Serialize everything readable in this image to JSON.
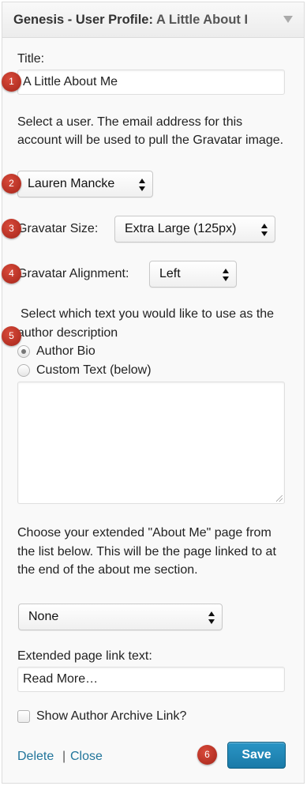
{
  "header": {
    "title_prefix": "Genesis - User Profile",
    "title_separator": ":",
    "instance_title": "A Little About I"
  },
  "fields": {
    "title_label": "Title:",
    "title_value": "A Little About Me",
    "user_help": "Select a user. The email address for this account will be used to pull the Gravatar image.",
    "user_selected": "Lauren Mancke",
    "gravatar_size_label": "Gravatar Size:",
    "gravatar_size_selected": "Extra Large (125px)",
    "gravatar_alignment_label": "Gravatar Alignment:",
    "gravatar_alignment_selected": "Left",
    "description_help": "Select which text you would like to use as the author description",
    "radio_author_bio": "Author Bio",
    "radio_custom_text": "Custom Text (below)",
    "custom_text_value": "",
    "about_page_help": "Choose your extended \"About Me\" page from the list below. This will be the page linked to at the end of the about me section.",
    "about_page_selected": "None",
    "link_text_label": "Extended page link text:",
    "link_text_value": "Read More…",
    "archive_link_label": "Show Author Archive Link?"
  },
  "state": {
    "author_bio_checked": true,
    "custom_text_checked": false,
    "archive_link_checked": false
  },
  "footer": {
    "delete_label": "Delete",
    "separator": "|",
    "close_label": "Close",
    "save_label": "Save"
  },
  "badges": [
    "1",
    "2",
    "3",
    "4",
    "5",
    "6"
  ],
  "colors": {
    "link": "#21759b",
    "save_button": "#1f86b8",
    "badge": "#b83226"
  }
}
